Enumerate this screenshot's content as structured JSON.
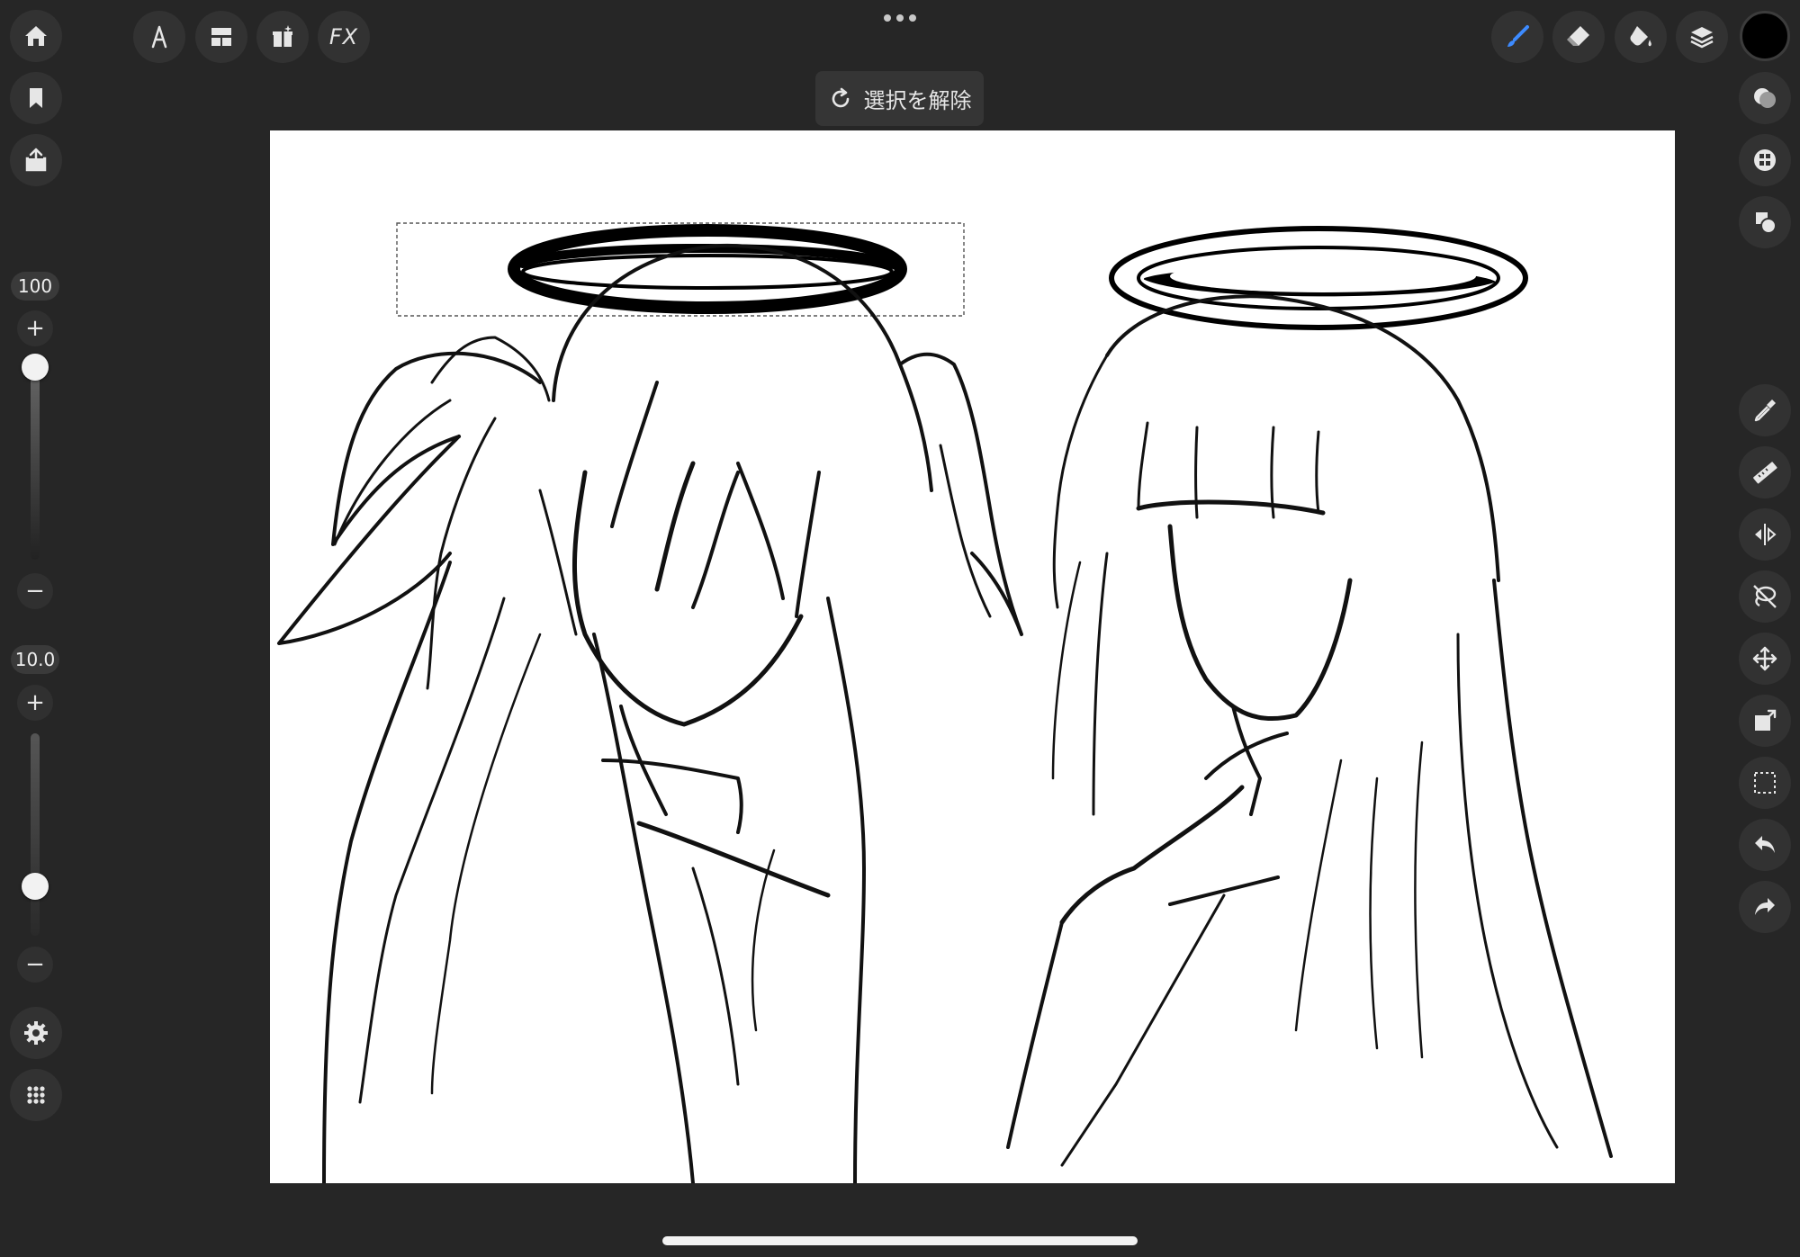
{
  "toolbar": {
    "more_icon": "ellipsis-icon",
    "deselect_label": "選択を解除",
    "fx_label": "FX"
  },
  "left_panel": {
    "opacity_value": "100",
    "opacity_level": 1.0,
    "size_value": "10.0",
    "size_level": 0.23
  },
  "colors": {
    "background": "#262626",
    "button": "#323232",
    "brush_accent": "#3d8bff",
    "current_color": "#000000",
    "canvas": "#ffffff"
  },
  "icons": {
    "left": [
      "home-icon",
      "bookmark-icon",
      "share-icon",
      "settings-icon",
      "apps-grid-icon"
    ],
    "top_left": [
      "text-tool-icon",
      "layout-icon",
      "gift-icon",
      "fx-icon"
    ],
    "top_right": [
      "brush-icon",
      "eraser-icon",
      "fill-bucket-icon",
      "layers-icon",
      "color-swatch"
    ],
    "right_upper": [
      "blend-icon",
      "texture-icon",
      "shape-overlap-icon"
    ],
    "right_lower": [
      "eyedropper-icon",
      "ruler-icon",
      "symmetry-icon",
      "lasso-icon",
      "move-icon",
      "transform-icon",
      "selection-icon",
      "undo-icon",
      "redo-icon"
    ]
  }
}
